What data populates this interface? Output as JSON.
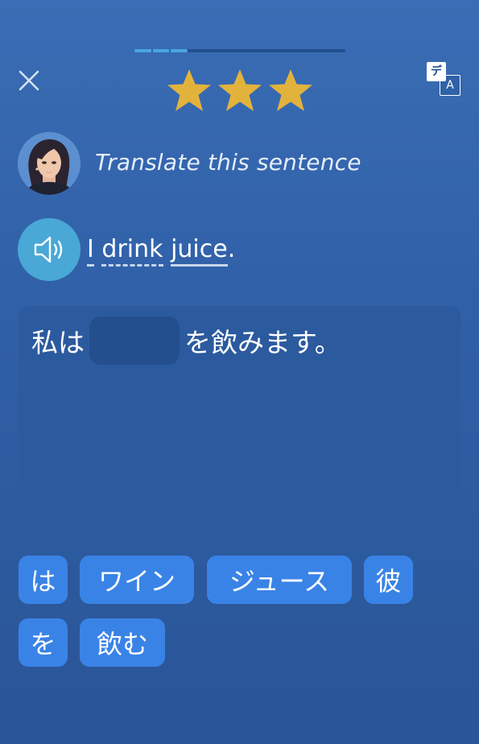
{
  "progress": {
    "fraction": 0.25,
    "segments_filled": 3
  },
  "header": {
    "close_icon": "close-icon",
    "stars_count": 3,
    "star_color": "#e2b33c",
    "translate_icon": {
      "top": "デ",
      "bottom": "A"
    }
  },
  "prompt": {
    "instruction": "Translate this sentence",
    "sentence_words": [
      {
        "text": "I",
        "underline": "solid"
      },
      {
        "text": "drink",
        "underline": "dashed"
      },
      {
        "text": "juice",
        "underline": "solid"
      }
    ],
    "sentence_end": "."
  },
  "answer": {
    "before_blank": "私は",
    "after_blank": "を飲みます。"
  },
  "chips": [
    "は",
    "ワイン",
    "ジュース",
    "彼",
    "を",
    "飲む"
  ],
  "colors": {
    "background": "#2f5fa6",
    "chip": "#3a83e6",
    "speaker": "#49a8d6",
    "panel": "#2c5a9e"
  }
}
